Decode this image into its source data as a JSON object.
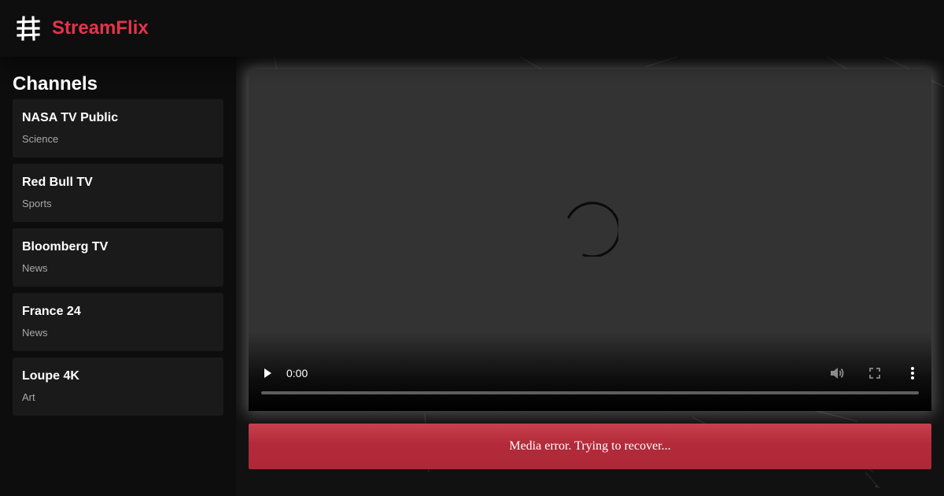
{
  "header": {
    "logo_text": "StreamFlix",
    "logo_icon": "hash-icon",
    "brand_color": "#e5334b"
  },
  "sidebar": {
    "title": "Channels",
    "channels": [
      {
        "name": "NASA TV Public",
        "category": "Science"
      },
      {
        "name": "Red Bull TV",
        "category": "Sports"
      },
      {
        "name": "Bloomberg TV",
        "category": "News"
      },
      {
        "name": "France 24",
        "category": "News"
      },
      {
        "name": "Loupe 4K",
        "category": "Art"
      }
    ]
  },
  "player": {
    "state": "loading",
    "time": "0:00",
    "progress": 0,
    "icons": [
      "play-icon",
      "volume-icon",
      "fullscreen-icon",
      "more-options-icon"
    ]
  },
  "error": {
    "message": "Media error. Trying to recover...",
    "color": "#b32b3a"
  }
}
